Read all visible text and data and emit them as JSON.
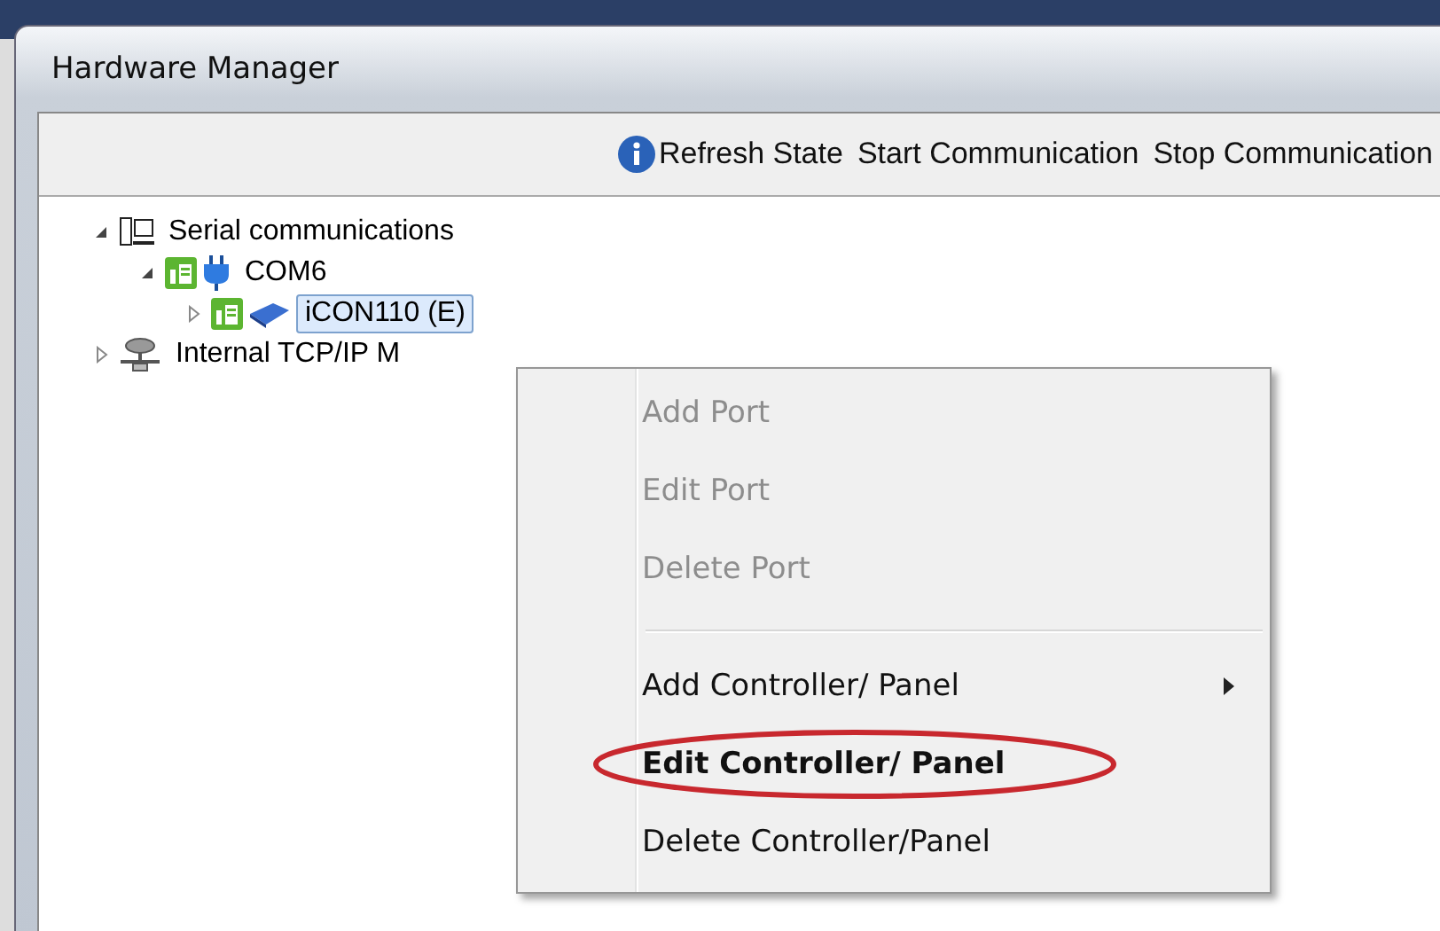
{
  "window": {
    "title": "Hardware Manager"
  },
  "toolbar": [
    {
      "label": "Refresh State"
    },
    {
      "label": "Start Communication"
    },
    {
      "label": "Stop Communication"
    }
  ],
  "tree": [
    {
      "label": "Serial communications",
      "kind": "computer",
      "expanded": true,
      "selected": false,
      "children": [
        {
          "label": "COM6",
          "kind": "port",
          "expanded": true,
          "selected": false,
          "children": [
            {
              "label": "iCON110  (E)",
              "kind": "controller",
              "expanded": false,
              "selected": true
            }
          ]
        }
      ]
    },
    {
      "label": "Internal TCP/IP M",
      "kind": "network",
      "expanded": false,
      "selected": false
    }
  ],
  "context_menu": [
    {
      "kind": "item",
      "label": "Add Port",
      "disabled": true,
      "submenu": false,
      "circled": false
    },
    {
      "kind": "item",
      "label": "Edit Port",
      "disabled": true,
      "submenu": false,
      "circled": false
    },
    {
      "kind": "item",
      "label": "Delete Port",
      "disabled": true,
      "submenu": false,
      "circled": false
    },
    {
      "kind": "separator"
    },
    {
      "kind": "item",
      "label": "Add Controller/ Panel",
      "disabled": false,
      "submenu": true,
      "circled": false
    },
    {
      "kind": "item",
      "label": "Edit Controller/ Panel",
      "disabled": false,
      "submenu": false,
      "circled": true
    },
    {
      "kind": "item",
      "label": "Delete Controller/Panel",
      "disabled": false,
      "submenu": false,
      "circled": false
    }
  ]
}
